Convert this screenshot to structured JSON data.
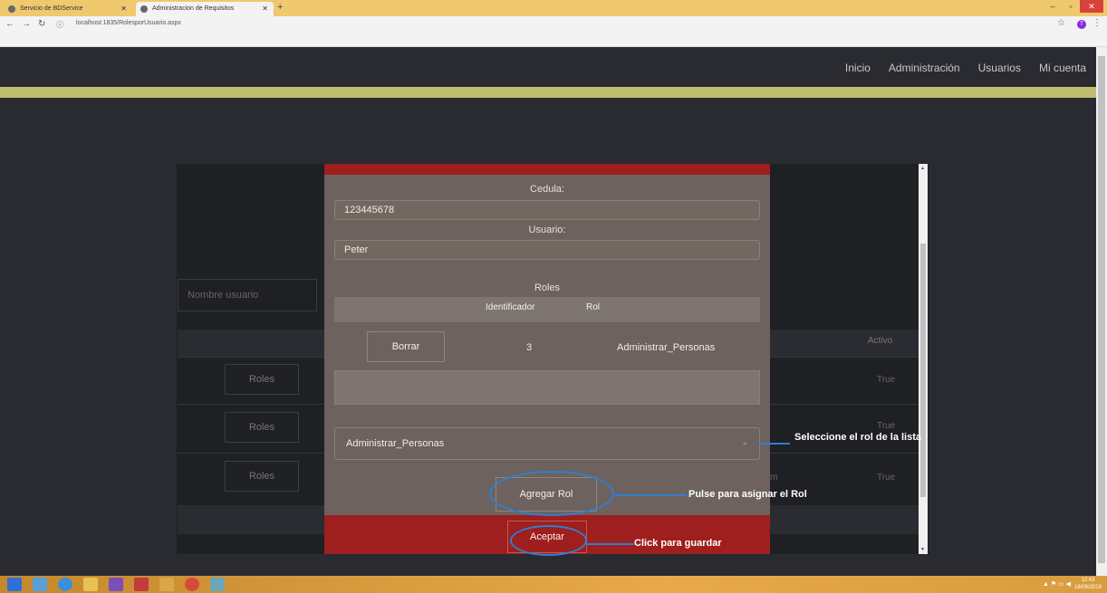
{
  "browser": {
    "tabs": [
      {
        "label": "Servicio de BDService"
      },
      {
        "label": "Administracion de Requisitos"
      }
    ],
    "url": "localhost:1835/RolesporUsuario.aspx",
    "profile_initial": "T"
  },
  "nav": {
    "items": [
      "Inicio",
      "Administración",
      "Usuarios",
      "Mi cuenta"
    ]
  },
  "background_page": {
    "search_placeholder": "Nombre usuario",
    "column_header": "Activo",
    "rows": [
      {
        "button": "Roles",
        "activo": "True"
      },
      {
        "button": "Roles",
        "activo": "True"
      },
      {
        "button": "Roles",
        "activo": "True"
      }
    ],
    "partial_text": "m"
  },
  "modal": {
    "cedula_label": "Cedula:",
    "cedula_value": "123445678",
    "usuario_label": "Usuario:",
    "usuario_value": "Peter",
    "roles_title": "Roles",
    "col_identificador": "Identificador",
    "col_rol": "Rol",
    "row": {
      "button": "Borrar",
      "id": "3",
      "rol": "Administrar_Personas"
    },
    "select_value": "Administrar_Personas",
    "agregar_label": "Agregar Rol",
    "aceptar_label": "Aceptar"
  },
  "annotations": {
    "select_hint": "Seleccione el rol de la lista",
    "agregar_hint": "Pulse para asignar el Rol",
    "aceptar_hint": "Click para guardar"
  },
  "taskbar": {
    "time": "12:43",
    "date": "18/08/2019"
  },
  "colors": {
    "modal_bg": "#6d625e",
    "modal_accent": "#9e1f1d",
    "annotation_blue": "#2f7fd0",
    "olive_bar": "#bdbd6e"
  }
}
